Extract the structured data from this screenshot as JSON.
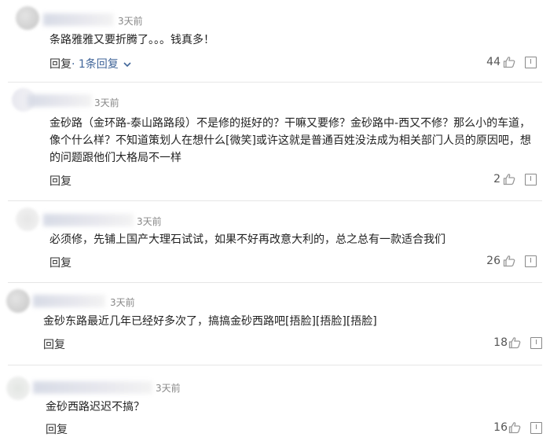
{
  "comments": [
    {
      "time": "3天前",
      "text": "条路雅雅又要折腾了。。。钱真多！",
      "reply_label": "回复",
      "replies_link": "· 1条回复",
      "likes": "44"
    },
    {
      "time": "3天前",
      "text": "金砂路（金环路-泰山路路段）不是修的挺好的？干嘛又要修？金砂路中-西又不修？那么小的车道，\n像个什么样？不知道策划人在想什么[微笑]或许这就是普通百姓没法成为相关部门人员的原因吧，想\n的问题跟他们大格局不一样",
      "reply_label": "回复",
      "likes": "2"
    },
    {
      "time": "3天前",
      "text": "必须修，先铺上国产大理石试试，如果不好再改意大利的，总之总有一款适合我们",
      "reply_label": "回复",
      "likes": "26"
    },
    {
      "time": "3天前",
      "text": "金砂东路最近几年已经好多次了，搞搞金砂西路吧[捂脸][捂脸][捂脸]",
      "reply_label": "回复",
      "likes": "18"
    },
    {
      "time": "3天前",
      "text": "金砂西路迟迟不搞？",
      "reply_label": "回复",
      "likes": "16"
    }
  ]
}
